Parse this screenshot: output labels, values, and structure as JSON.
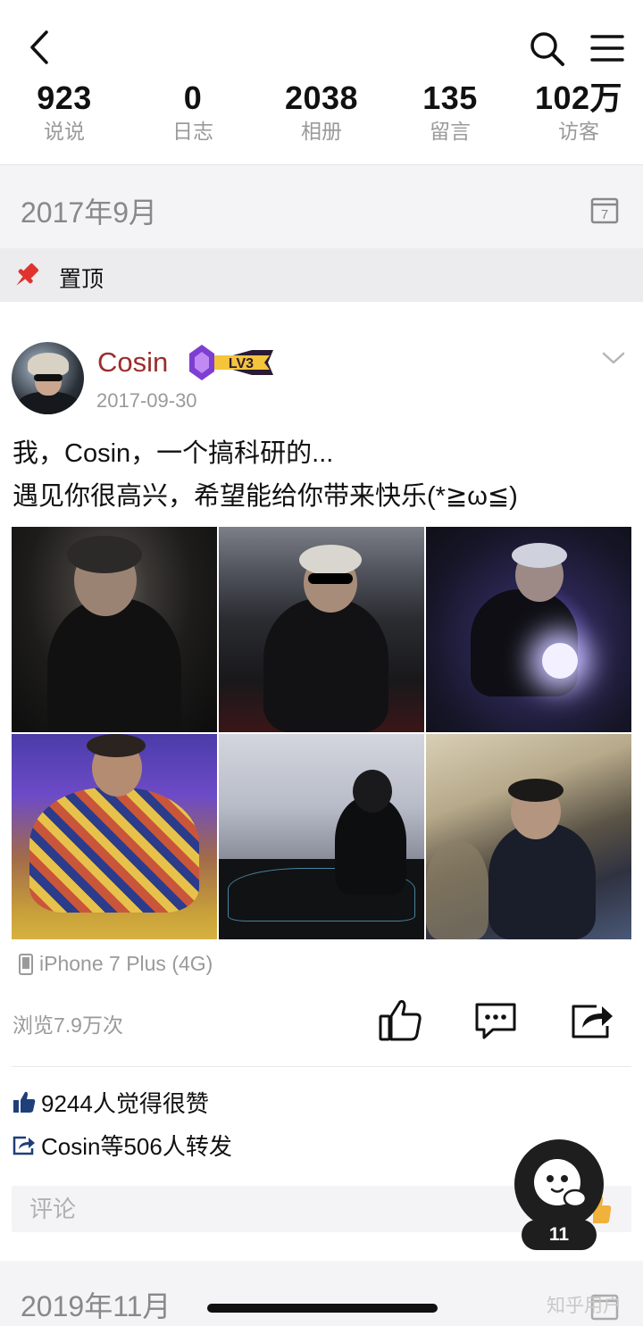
{
  "header": {
    "stats": [
      {
        "value": "923",
        "label": "说说"
      },
      {
        "value": "0",
        "label": "日志"
      },
      {
        "value": "2038",
        "label": "相册"
      },
      {
        "value": "135",
        "label": "留言"
      },
      {
        "value": "102万",
        "label": "访客"
      }
    ]
  },
  "sections": {
    "first_month": "2017年9月",
    "second_month": "2019年11月",
    "pinned_label": "置顶"
  },
  "post": {
    "author": "Cosin",
    "level": "LV3",
    "date": "2017-09-30",
    "text_lines": [
      "我，Cosin，一个搞科研的...",
      "遇见你很高兴，希望能给你带来快乐(*≧ω≦)"
    ],
    "device": "iPhone 7 Plus (4G)",
    "views": "浏览7.9万次",
    "likes": "9244人觉得很赞",
    "shares": "Cosin等506人转发",
    "comment_placeholder": "评论"
  },
  "floating": {
    "badge": "11"
  },
  "watermark": "知乎用户",
  "colors": {
    "author_name": "#9b2d2d",
    "accent_pin": "#e0332f",
    "level_badge_gold": "#f4c43a",
    "level_badge_purple": "#7d3fd1",
    "like_blue": "#1e3f7a"
  },
  "icons": [
    "back-arrow-icon",
    "search-icon",
    "menu-icon",
    "calendar-icon",
    "pin-icon",
    "chevron-down-icon",
    "phone-icon",
    "thumbs-up-icon",
    "comment-icon",
    "share-icon"
  ]
}
